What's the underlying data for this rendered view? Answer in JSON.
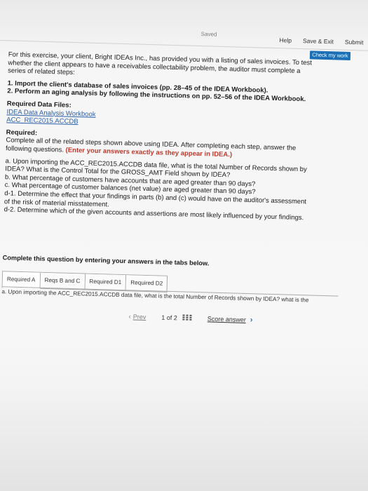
{
  "header": {
    "status": "Saved",
    "actions": [
      "Help",
      "Save & Exit",
      "Submit"
    ],
    "check_button": "Check my work"
  },
  "problem": {
    "intro": "For this exercise, your client, Bright IDEAs Inc., has provided you with a listing of sales invoices. To test whether the client appears to have a receivables collectability problem, the auditor must complete a series of related steps:",
    "steps": [
      "1. Import the client's database of sales invoices (pp. 28–45 of the IDEA Workbook).",
      "2. Perform an aging analysis by following the instructions on pp. 52–56 of the IDEA Workbook."
    ],
    "files_heading": "Required Data Files:",
    "files": [
      "IDEA Data Analysis Workbook",
      "ACC_REC2015.ACCDB"
    ],
    "required_heading": "Required:",
    "required_text": "Complete all of the related steps shown above using IDEA. After completing each step, answer the following questions.",
    "required_note": "(Enter your answers exactly as they appear in IDEA.)",
    "questions": [
      "a. Upon importing the ACC_REC2015.ACCDB data file, what is the total Number of Records shown by IDEA? What is the Control Total for the GROSS_AMT Field shown by IDEA?",
      "b. What percentage of customers have accounts that are aged greater than 90 days?",
      "c. What percentage of customer balances (net value) are aged greater than 90 days?",
      "d-1. Determine the effect that your findings in parts (b) and (c) would have on the auditor's assessment of the risk of material misstatement.",
      "d-2. Determine which of the given accounts and assertions are most likely influenced by your findings."
    ]
  },
  "complete_instruction": "Complete this question by entering your answers in the tabs below.",
  "tabs": [
    "Required A",
    "Reqs B and C",
    "Required D1",
    "Required D2"
  ],
  "active_tab_question": "a. Upon importing the ACC_REC2015.ACCDB data file, what is the total Number of Records shown by IDEA? what is the",
  "pager": {
    "prev": "Prev",
    "page": "1 of 2",
    "score": "Score answer"
  }
}
